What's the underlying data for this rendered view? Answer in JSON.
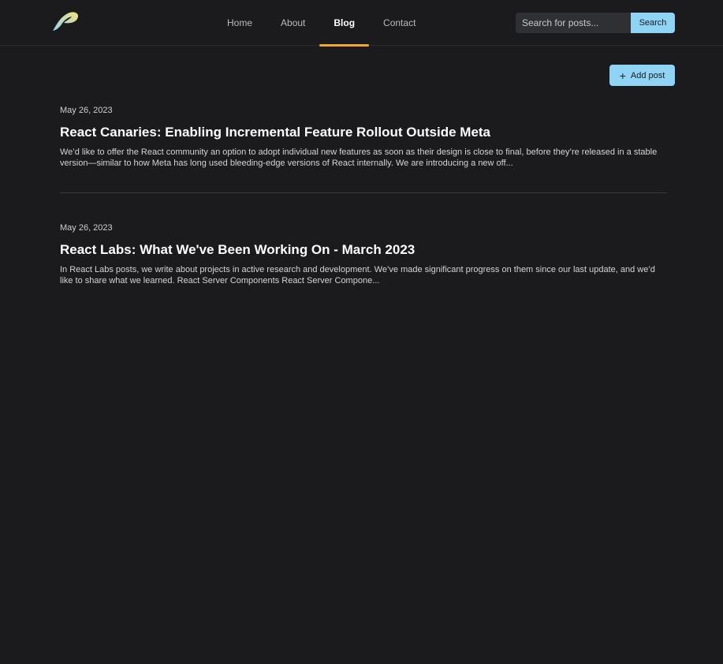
{
  "nav": {
    "logo_icon": "leaf-p-logo-icon",
    "items": [
      {
        "label": "Home"
      },
      {
        "label": "About"
      },
      {
        "label": "Blog",
        "active": true
      },
      {
        "label": "Contact"
      }
    ]
  },
  "search": {
    "placeholder": "Search for posts...",
    "button_label": "Search"
  },
  "actions": {
    "add_post_label": "Add post",
    "add_post_icon": "plus-icon"
  },
  "posts": [
    {
      "date": "May 26, 2023",
      "title": "React Canaries: Enabling Incremental Feature Rollout Outside Meta",
      "excerpt": "We’d like to offer the React community an option to adopt individual new features as soon as their design is close to final, before they’re released in a stable version—similar to how Meta has long used bleeding-edge versions of React internally. We are introducing a new off..."
    },
    {
      "date": "May 26, 2023",
      "title": "React Labs: What We've Been Working On - March 2023",
      "excerpt": "In React Labs posts, we write about projects in active research and development. We’ve made significant progress on them since our last update, and we’d like to share what we learned. React Server Components React Server Compone..."
    }
  ],
  "colors": {
    "background": "#1b1b1d",
    "accent": "#8fd3f5",
    "active_underline": "#f4a82a"
  }
}
